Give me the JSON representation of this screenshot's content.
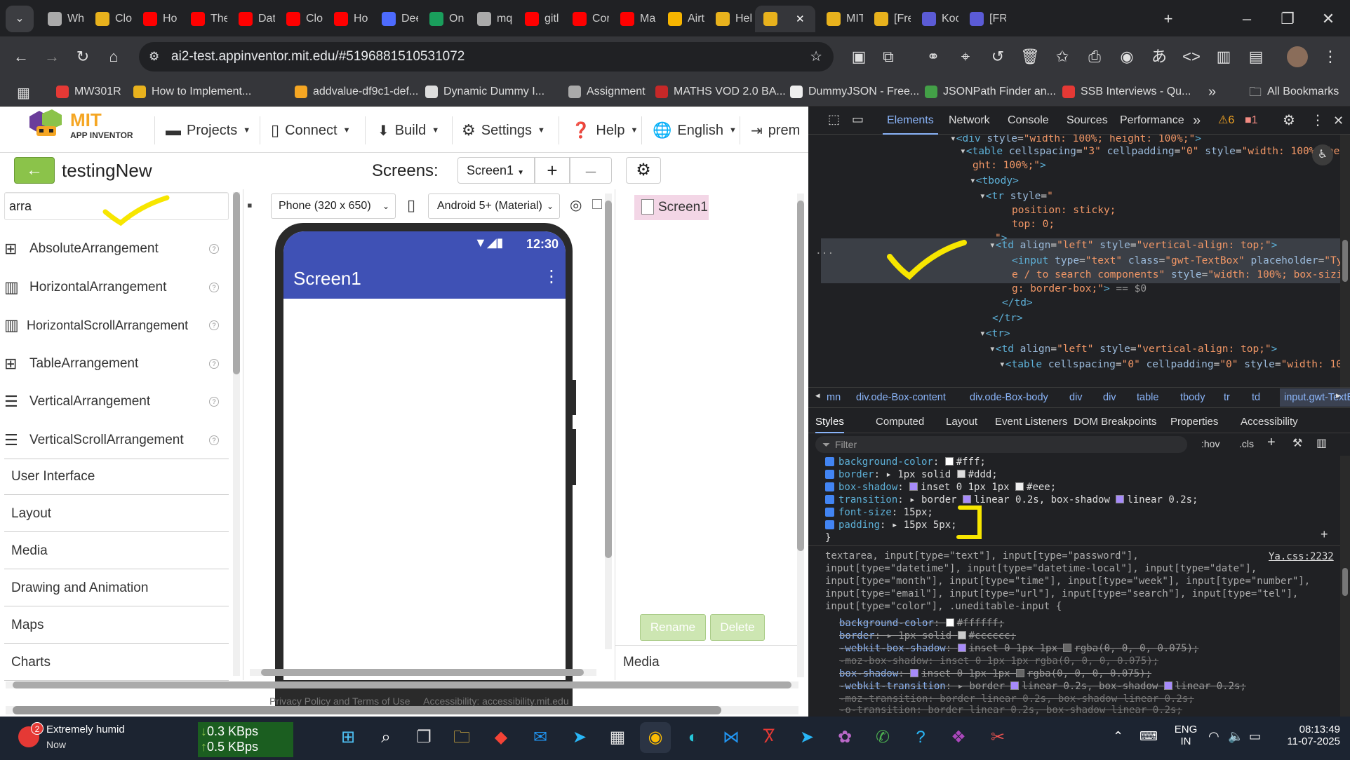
{
  "browser": {
    "tabs": [
      {
        "label": "Wh",
        "color": "#aaa"
      },
      {
        "label": "Clo",
        "color": "#e8b21d"
      },
      {
        "label": "Ho",
        "color": "#ff0000"
      },
      {
        "label": "The",
        "color": "#ff0000"
      },
      {
        "label": "Dat",
        "color": "#ff0000"
      },
      {
        "label": "Clo",
        "color": "#ff0000"
      },
      {
        "label": "Ho",
        "color": "#ff0000"
      },
      {
        "label": "Dee",
        "color": "#4d6bfe"
      },
      {
        "label": "On",
        "color": "#1a9e5c"
      },
      {
        "label": "mq",
        "color": "#aaa"
      },
      {
        "label": "gitl",
        "color": "#ff0000"
      },
      {
        "label": "Cor",
        "color": "#ff0000"
      },
      {
        "label": "Ma",
        "color": "#ff0000"
      },
      {
        "label": "Airt",
        "color": "#f7b500"
      },
      {
        "label": "Hel",
        "color": "#e8b21d"
      },
      {
        "label": "",
        "color": "#e8b21d",
        "active": true
      },
      {
        "label": "MIT",
        "color": "#e8b21d"
      },
      {
        "label": "[Fre",
        "color": "#e8b21d"
      },
      {
        "label": "Koc",
        "color": "#5b5bd6"
      },
      {
        "label": "[FR",
        "color": "#5b5bd6"
      }
    ],
    "url": "ai2-test.appinventor.mit.edu/#5196881510531072",
    "bookmarks": [
      {
        "label": "MW301R",
        "color": "#e53935"
      },
      {
        "label": "How to Implement...",
        "color": "#e8b21d"
      },
      {
        "label": "addvalue-df9c1-def...",
        "color": "#f5a623"
      },
      {
        "label": "Dynamic Dummy I...",
        "color": "#ddd"
      },
      {
        "label": "Assignment",
        "color": "#aaa"
      },
      {
        "label": "MATHS VOD 2.0 BA...",
        "color": "#c62828"
      },
      {
        "label": "DummyJSON - Free...",
        "color": "#eee"
      },
      {
        "label": "JSONPath Finder an...",
        "color": "#43a047"
      },
      {
        "label": "SSB Interviews - Qu...",
        "color": "#e53935"
      }
    ],
    "all_bookmarks": "All Bookmarks"
  },
  "app": {
    "logo_top": "MIT",
    "logo_bottom": "APP INVENTOR",
    "menus": [
      "Projects",
      "Connect",
      "Build",
      "Settings",
      "Help",
      "English",
      "prem"
    ],
    "project_name": "testingNew",
    "screens_label": "Screens:",
    "screen_select": "Screen1",
    "search_value": "arra",
    "palette_items": [
      {
        "label": "AbsoluteArrangement",
        "icon": "grid-icon"
      },
      {
        "label": "HorizontalArrangement",
        "icon": "columns-icon"
      },
      {
        "label": "HorizontalScrollArrangement",
        "icon": "columns-icon"
      },
      {
        "label": "TableArrangement",
        "icon": "grid-icon"
      },
      {
        "label": "VerticalArrangement",
        "icon": "rows-icon"
      },
      {
        "label": "VerticalScrollArrangement",
        "icon": "rows-icon"
      }
    ],
    "categories": [
      "User Interface",
      "Layout",
      "Media",
      "Drawing and Animation",
      "Maps",
      "Charts"
    ],
    "device_select": "Phone (320 x 650)",
    "theme_select": "Android 5+ (Material)",
    "phone_time": "12:30",
    "phone_title": "Screen1",
    "components_root": "Screen1",
    "rename_label": "Rename",
    "delete_label": "Delete",
    "media_label": "Media",
    "footer_text": "Privacy Policy and Terms of Use     Accessibility: accessibility.mit.edu"
  },
  "devtools": {
    "tabs": [
      "Elements",
      "Network",
      "Console",
      "Sources",
      "Performance"
    ],
    "warn_count": "6",
    "err_count": "1",
    "breadcrumbs": [
      "mn",
      "div.ode-Box-content",
      "div.ode-Box-body",
      "div",
      "div",
      "table",
      "tbody",
      "tr",
      "td",
      "input.gwt-TextBox"
    ],
    "style_tabs": [
      "Styles",
      "Computed",
      "Layout",
      "Event Listeners",
      "DOM Breakpoints",
      "Properties",
      "Accessibility"
    ],
    "filter_placeholder": "Filter",
    "hov": ":hov",
    "cls": ".cls",
    "rule_source": "Ya.css:2232",
    "rule_selector": "textarea, input[type=\"text\"], input[type=\"password\"],\ninput[type=\"datetime\"], input[type=\"datetime-local\"], input[type=\"date\"],\ninput[type=\"month\"], input[type=\"time\"], input[type=\"week\"], input[type=\"number\"],\ninput[type=\"email\"], input[type=\"url\"], input[type=\"search\"], input[type=\"tel\"],\ninput[type=\"color\"], .uneditable-input {"
  },
  "taskbar": {
    "weather_title": "Extremely humid",
    "weather_sub": "Now",
    "weather_badge": "2",
    "net_up": "0.3 KBps",
    "net_down": "0.5 KBps",
    "lang_top": "ENG",
    "lang_bottom": "IN",
    "time": "08:13:49",
    "date": "11-07-2025"
  }
}
